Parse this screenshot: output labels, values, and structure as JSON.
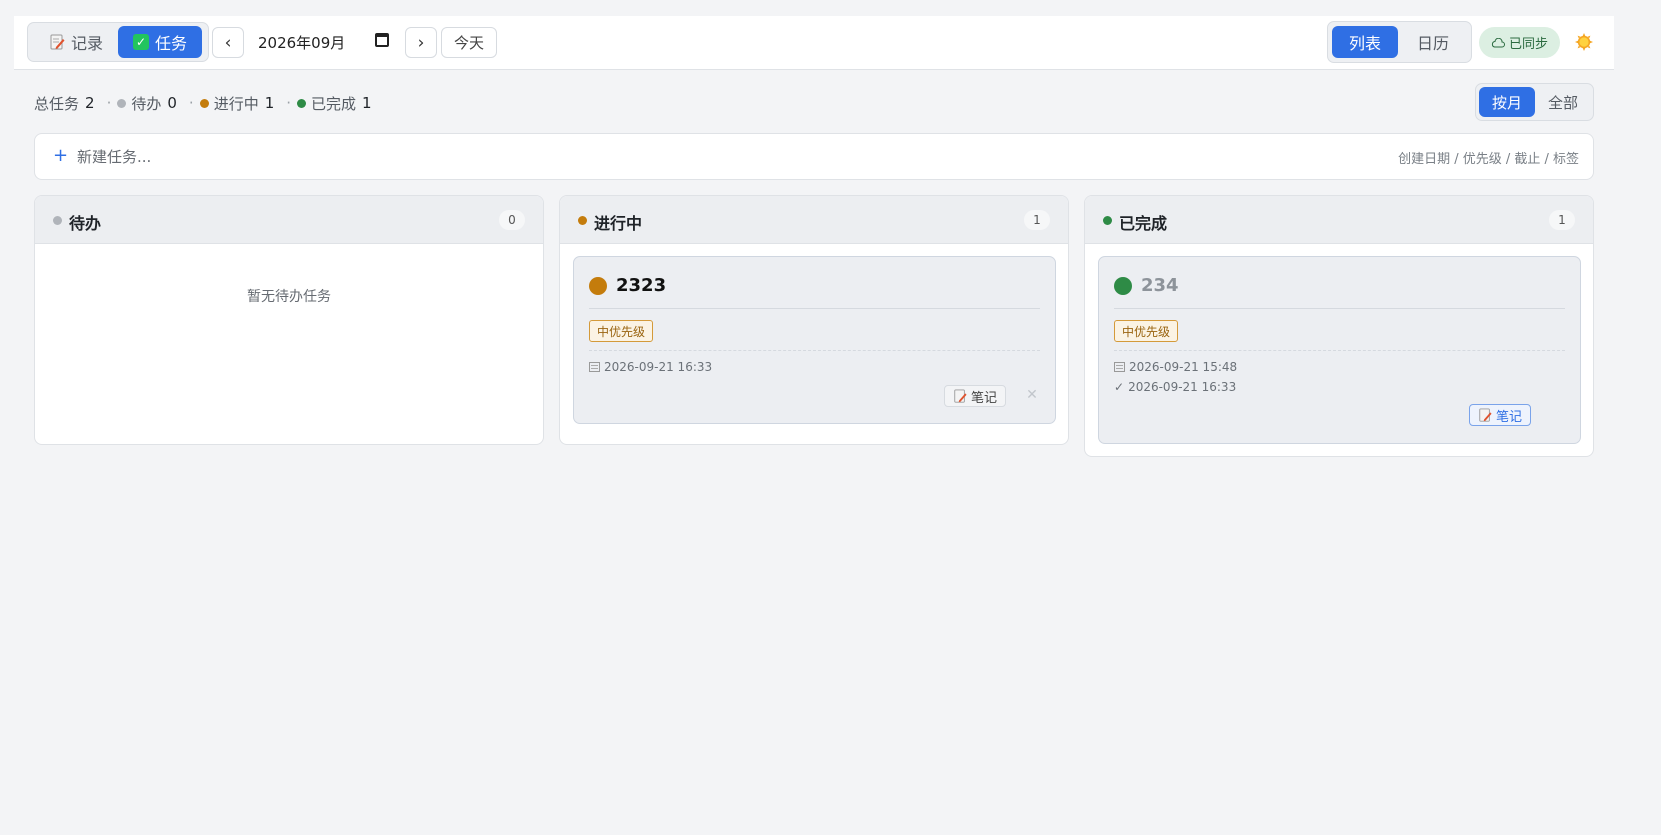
{
  "header": {
    "mode_tabs": {
      "records": "记录",
      "tasks": "任务"
    },
    "prev_label": "‹",
    "next_label": "›",
    "month": "2026年09月",
    "today_label": "今天",
    "view_tabs": {
      "list": "列表",
      "calendar": "日历"
    },
    "sync_status": "已同步"
  },
  "stats": {
    "total_label": "总任务",
    "total": "2",
    "todo_label": "待办",
    "todo": "0",
    "doing_label": "进行中",
    "doing": "1",
    "done_label": "已完成",
    "done": "1",
    "separator": "·"
  },
  "range_tabs": {
    "month": "按月",
    "all": "全部"
  },
  "new_task": {
    "plus": "+",
    "placeholder": "新建任务...",
    "hint": "创建日期 / 优先级 / 截止 / 标签"
  },
  "columns": {
    "todo": {
      "title": "待办",
      "count": "0",
      "empty": "暂无待办任务"
    },
    "doing": {
      "title": "进行中",
      "count": "1",
      "card": {
        "title": "2323",
        "priority": "中优先级",
        "created": "2026-09-21 16:33",
        "note_label": "笔记",
        "delete_label": "✕"
      }
    },
    "done": {
      "title": "已完成",
      "count": "1",
      "card": {
        "title": "234",
        "priority": "中优先级",
        "created": "2026-09-21 15:48",
        "completed": "2026-09-21 16:33",
        "completed_mark": "✓",
        "note_label": "笔记"
      }
    }
  },
  "colors": {
    "accent": "#2f6fe4",
    "todo": "#b0b4ba",
    "doing": "#c47c0c",
    "done": "#2e8b46"
  }
}
